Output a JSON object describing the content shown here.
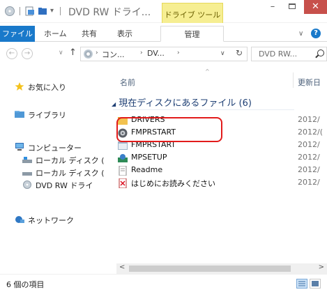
{
  "window": {
    "title": "DVD RW ドライ...",
    "context_tab": "ドライブ ツール",
    "minimize_glyph": "–",
    "close_glyph": "✕"
  },
  "ribbon": {
    "file_tab": "ファイル",
    "tabs": [
      "ホーム",
      "共有",
      "表示",
      "管理"
    ],
    "chevron_glyph": "∨",
    "help_glyph": "?"
  },
  "address": {
    "back_glyph": "←",
    "forward_glyph": "→",
    "recent_glyph": "∨",
    "up_glyph": "↑",
    "segments": [
      "コン...",
      "DV..."
    ],
    "separator_glyph": "›",
    "dropdown_glyph": "∨",
    "refresh_glyph": "↻",
    "search_placeholder": "DVD RW..."
  },
  "nav": {
    "items": [
      {
        "label": "お気に入り",
        "icon": "star-icon"
      },
      {
        "label": "ライブラリ",
        "icon": "library-icon"
      },
      {
        "label": "コンピューター",
        "icon": "computer-icon"
      },
      {
        "label": "ローカル ディスク (",
        "icon": "local-disk-icon"
      },
      {
        "label": "ローカル ディスク (",
        "icon": "local-disk-icon"
      },
      {
        "label": "DVD RW ドライ",
        "icon": "dvd-drive-icon"
      },
      {
        "label": "ネットワーク",
        "icon": "network-icon"
      }
    ]
  },
  "content": {
    "column_name": "名前",
    "column_date": "更新日",
    "sort_glyph": "^",
    "group_label": "現在ディスクにあるファイル (6)",
    "group_glyph": "◢",
    "files": [
      {
        "name": "DRIVERS",
        "date": "2012/",
        "icon": "folder-icon"
      },
      {
        "name": "FMPRSTART",
        "date": "2012/(",
        "icon": "autorun-disc-icon"
      },
      {
        "name": "FMPRSTART",
        "date": "2012/",
        "icon": "application-icon"
      },
      {
        "name": "MPSETUP",
        "date": "2012/",
        "icon": "setup-icon"
      },
      {
        "name": "Readme",
        "date": "2012/",
        "icon": "text-document-icon"
      },
      {
        "name": "はじめにお読みください",
        "date": "2012/",
        "icon": "pdf-icon"
      }
    ]
  },
  "scrollbar": {
    "left_glyph": "<",
    "right_glyph": ">"
  },
  "status": {
    "item_count": "6 個の項目"
  },
  "colors": {
    "accent": "#1979ca",
    "close_button": "#c7504b",
    "context_tab": "#f6ee92",
    "highlight": "#e21b1b",
    "group_text": "#1e3f74"
  }
}
